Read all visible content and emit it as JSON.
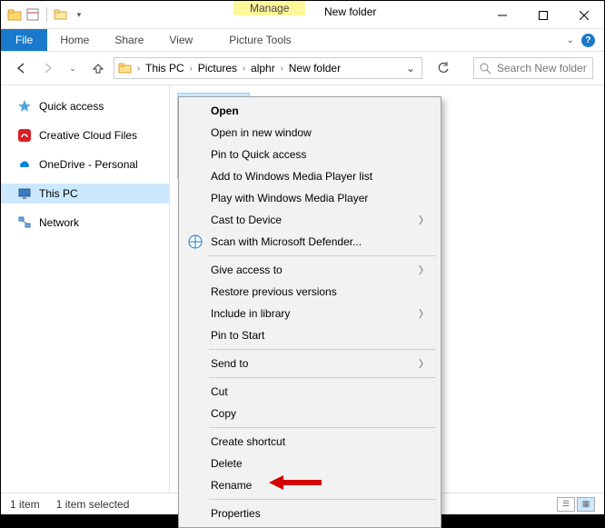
{
  "title": "New folder",
  "ribbon_context_group": "Manage",
  "ribbon_context_tab": "Picture Tools",
  "tabs": {
    "file": "File",
    "home": "Home",
    "share": "Share",
    "view": "View"
  },
  "breadcrumb": [
    "This PC",
    "Pictures",
    "alphr",
    "New folder"
  ],
  "search_placeholder": "Search New folder",
  "sidebar": {
    "quick_access": "Quick access",
    "creative_cloud": "Creative Cloud Files",
    "onedrive": "OneDrive - Personal",
    "this_pc": "This PC",
    "network": "Network"
  },
  "context_menu": {
    "open": "Open",
    "open_new": "Open in new window",
    "pin_quick": "Pin to Quick access",
    "add_wmp": "Add to Windows Media Player list",
    "play_wmp": "Play with Windows Media Player",
    "cast": "Cast to Device",
    "scan": "Scan with Microsoft Defender...",
    "give_access": "Give access to",
    "restore": "Restore previous versions",
    "include_lib": "Include in library",
    "pin_start": "Pin to Start",
    "send_to": "Send to",
    "cut": "Cut",
    "copy": "Copy",
    "shortcut": "Create shortcut",
    "delete": "Delete",
    "rename": "Rename",
    "properties": "Properties"
  },
  "status": {
    "count": "1 item",
    "selected": "1 item selected"
  }
}
